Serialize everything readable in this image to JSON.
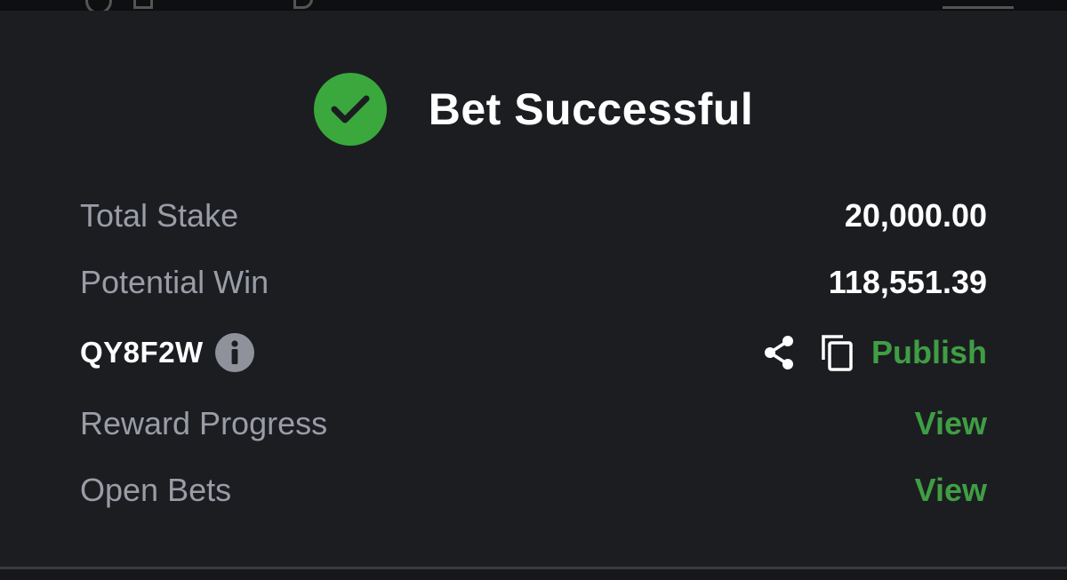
{
  "header": {
    "title": "Bet Successful",
    "icon": "check-circle-icon",
    "accent_color": "#3aa83c"
  },
  "details": {
    "total_stake": {
      "label": "Total Stake",
      "value": "20,000.00"
    },
    "potential_win": {
      "label": "Potential Win",
      "value": "118,551.39"
    },
    "booking": {
      "code": "QY8F2W",
      "info_icon": "info-icon",
      "share_icon": "share-icon",
      "copy_icon": "copy-icon",
      "publish_label": "Publish"
    },
    "reward_progress": {
      "label": "Reward Progress",
      "action": "View"
    },
    "open_bets": {
      "label": "Open Bets",
      "action": "View"
    }
  },
  "colors": {
    "background": "#1c1d21",
    "label": "#9a9ca6",
    "value": "#ffffff",
    "link": "#3f9e44"
  }
}
